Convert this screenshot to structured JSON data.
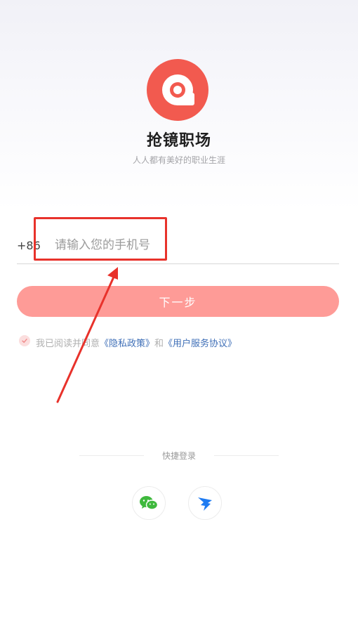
{
  "app": {
    "name": "抢镜职场",
    "slogan": "人人都有美好的职业生涯"
  },
  "login": {
    "country_code": "+86",
    "phone_placeholder": "请输入您的手机号",
    "next_label": "下一步"
  },
  "agreement": {
    "prefix": "我已阅读并同意",
    "privacy_link": "《隐私政策》",
    "conjunction": "和",
    "service_link": "《用户服务协议》"
  },
  "quick_login": {
    "label": "快捷登录",
    "providers": [
      "wechat-icon",
      "dingtalk-icon"
    ]
  },
  "colors": {
    "brand": "#f25a4f",
    "button": "#fe9b97",
    "link": "#3f6fb7",
    "annotation": "#e8322b"
  }
}
